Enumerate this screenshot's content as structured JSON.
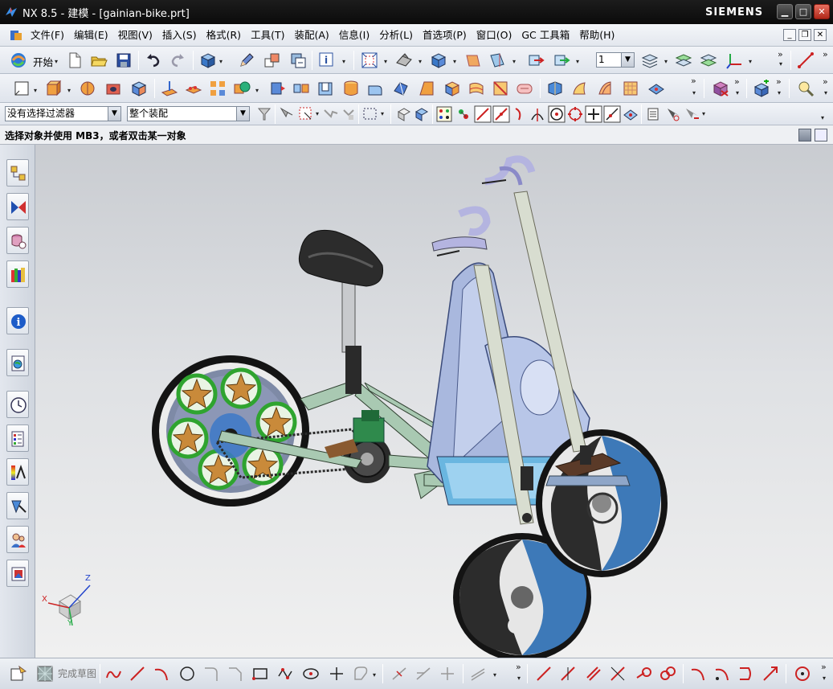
{
  "window": {
    "title": "NX 8.5 - 建模 - [gainian-bike.prt]",
    "brand": "SIEMENS",
    "minimize": "▁",
    "maximize": "□",
    "close": "✕"
  },
  "menu": {
    "items": [
      "文件(F)",
      "编辑(E)",
      "视图(V)",
      "插入(S)",
      "格式(R)",
      "工具(T)",
      "装配(A)",
      "信息(I)",
      "分析(L)",
      "首选项(P)",
      "窗口(O)",
      "GC 工具箱",
      "帮助(H)"
    ],
    "mdi_minimize": "_",
    "mdi_restore": "❐",
    "mdi_close": "✕"
  },
  "toolbar1": {
    "start_label": "开始",
    "layer_value": "1"
  },
  "filterbar": {
    "selection_filter": "没有选择过滤器",
    "assembly_scope": "整个装配"
  },
  "status": {
    "message": "选择对象并使用 MB3，或者双击某一对象"
  },
  "bottom": {
    "finish_sketch": "完成草图"
  },
  "triad": {
    "x": "X",
    "y": "Y",
    "z": "Z"
  },
  "colors": {
    "frame_green": "#a9c9b2",
    "wheel_blue": "#3d79b8",
    "fairing_blue": "#a9b8de",
    "star_gold": "#c98a3a",
    "ring_green": "#3aa43a",
    "handlebar_lilac": "#b4b4e0",
    "title_dark": "#111111"
  }
}
